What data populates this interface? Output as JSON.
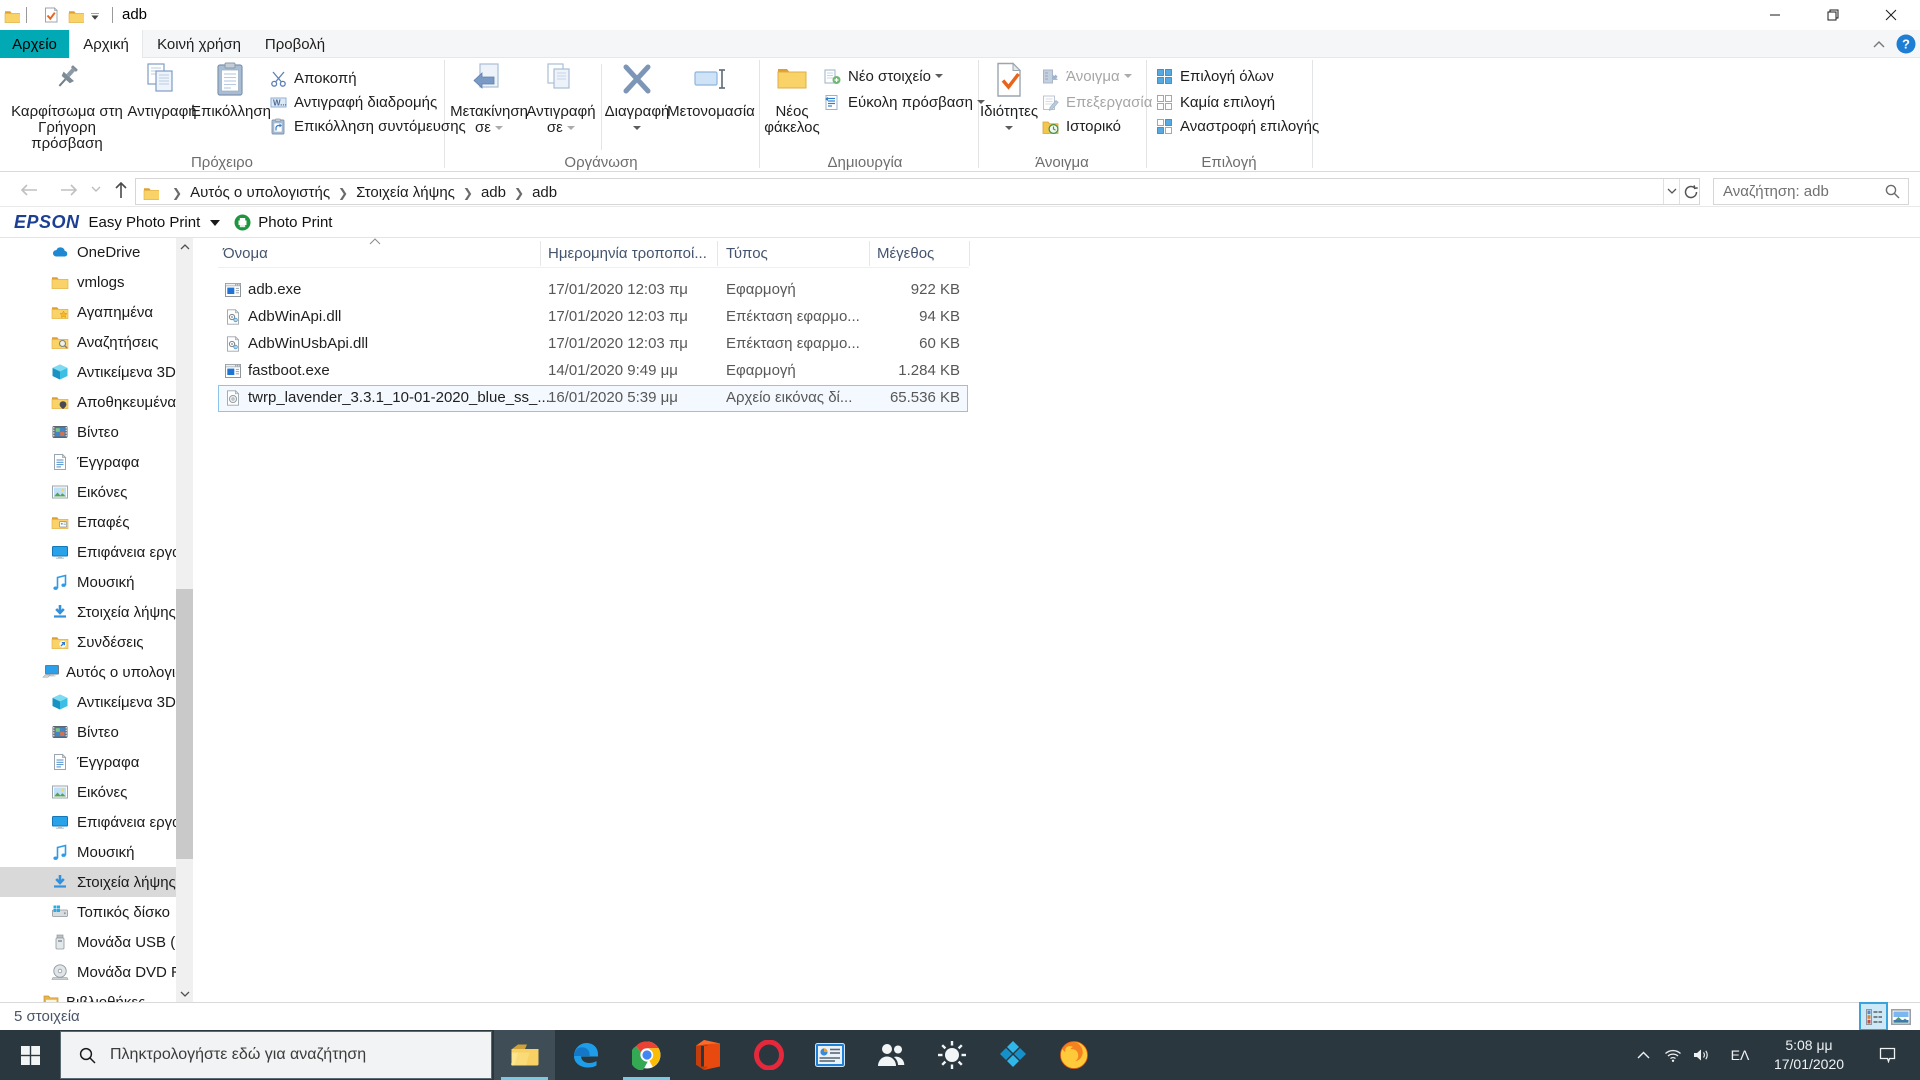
{
  "titlebar": {
    "title": "adb",
    "qat_icons": [
      "folder-icon",
      "properties-check-icon",
      "new-folder-icon",
      "customize-qat-caret"
    ],
    "window_buttons": [
      "minimize",
      "restore",
      "close"
    ]
  },
  "tabs": {
    "file_tab": "Αρχείο",
    "items": [
      {
        "label": "Αρχική",
        "active": true
      },
      {
        "label": "Κοινή χρήση",
        "active": false
      },
      {
        "label": "Προβολή",
        "active": false
      }
    ]
  },
  "ribbon": {
    "groups": [
      {
        "label": "Πρόχειρο"
      },
      {
        "label": "Οργάνωση"
      },
      {
        "label": "Δημιουργία"
      },
      {
        "label": "Άνοιγμα"
      },
      {
        "label": "Επιλογή"
      }
    ],
    "buttons": {
      "pin_line1": "Καρφίτσωμα στη",
      "pin_line2": "Γρήγορη πρόσβαση",
      "copy": "Αντιγραφή",
      "paste": "Επικόλληση",
      "cut": "Αποκοπή",
      "copy_path": "Αντιγραφή διαδρομής",
      "paste_shortcut": "Επικόλληση συντόμευσης",
      "move_to_line1": "Μετακίνηση",
      "move_to_line2": "σε",
      "copy_to_line1": "Αντιγραφή",
      "copy_to_line2": "σε",
      "delete": "Διαγραφή",
      "rename": "Μετονομασία",
      "new_folder_line1": "Νέος",
      "new_folder_line2": "φάκελος",
      "new_item": "Νέο στοιχείο",
      "easy_access": "Εύκολη πρόσβαση",
      "properties": "Ιδιότητες",
      "open": "Άνοιγμα",
      "edit": "Επεξεργασία",
      "history": "Ιστορικό",
      "select_all": "Επιλογή όλων",
      "select_none": "Καμία επιλογή",
      "invert_selection": "Αναστροφή επιλογής"
    }
  },
  "addressbar": {
    "breadcrumbs": [
      "Αυτός ο υπολογιστής",
      "Στοιχεία λήψης",
      "adb",
      "adb"
    ],
    "search_text": "Αναζήτηση: adb"
  },
  "epson_toolbar": {
    "brand": "EPSON",
    "menu_label": "Easy Photo Print",
    "button_label": "Photo Print"
  },
  "sidebar": {
    "items": [
      {
        "label": "OneDrive",
        "icon": "onedrive",
        "level": 1,
        "selected": false
      },
      {
        "label": "vmlogs",
        "icon": "folder",
        "level": 1,
        "selected": false
      },
      {
        "label": "Αγαπημένα",
        "icon": "folder-star",
        "level": 1,
        "selected": false
      },
      {
        "label": "Αναζητήσεις",
        "icon": "folder-search",
        "level": 1,
        "selected": false
      },
      {
        "label": "Αντικείμενα 3D",
        "icon": "cube",
        "level": 1,
        "selected": false
      },
      {
        "label": "Αποθηκευμένα παιχνίδια",
        "icon": "folder-saved",
        "level": 1,
        "selected": false
      },
      {
        "label": "Βίντεο",
        "icon": "video",
        "level": 1,
        "selected": false
      },
      {
        "label": "Έγγραφα",
        "icon": "document",
        "level": 1,
        "selected": false
      },
      {
        "label": "Εικόνες",
        "icon": "picture",
        "level": 1,
        "selected": false
      },
      {
        "label": "Επαφές",
        "icon": "folder-contact",
        "level": 1,
        "selected": false
      },
      {
        "label": "Επιφάνεια εργασίας",
        "icon": "desktop",
        "level": 1,
        "selected": false
      },
      {
        "label": "Μουσική",
        "icon": "music",
        "level": 1,
        "selected": false
      },
      {
        "label": "Στοιχεία λήψης",
        "icon": "download",
        "level": 1,
        "selected": false
      },
      {
        "label": "Συνδέσεις",
        "icon": "folder-link",
        "level": 1,
        "selected": false
      },
      {
        "label": "Αυτός ο υπολογιστής",
        "icon": "computer",
        "level": 0,
        "selected": false
      },
      {
        "label": "Αντικείμενα 3D",
        "icon": "cube",
        "level": 1,
        "selected": false
      },
      {
        "label": "Βίντεο",
        "icon": "video",
        "level": 1,
        "selected": false
      },
      {
        "label": "Έγγραφα",
        "icon": "document",
        "level": 1,
        "selected": false
      },
      {
        "label": "Εικόνες",
        "icon": "picture",
        "level": 1,
        "selected": false
      },
      {
        "label": "Επιφάνεια εργασίας",
        "icon": "desktop",
        "level": 1,
        "selected": false
      },
      {
        "label": "Μουσική",
        "icon": "music",
        "level": 1,
        "selected": false
      },
      {
        "label": "Στοιχεία λήψης",
        "icon": "download",
        "level": 1,
        "selected": true
      },
      {
        "label": "Τοπικός δίσκο",
        "icon": "disk",
        "level": 1,
        "selected": false
      },
      {
        "label": "Μονάδα USB (",
        "icon": "usb",
        "level": 1,
        "selected": false
      },
      {
        "label": "Μονάδα DVD R",
        "icon": "dvd",
        "level": 1,
        "selected": false
      },
      {
        "label": "Βιβλιοθήκες",
        "icon": "libraries",
        "level": 0,
        "selected": false
      }
    ]
  },
  "filelist": {
    "columns": [
      {
        "label": "Όνομα"
      },
      {
        "label": "Ημερομηνία τροποποί..."
      },
      {
        "label": "Τύπος"
      },
      {
        "label": "Μέγεθος"
      }
    ],
    "rows": [
      {
        "name": "adb.exe",
        "icon": "exe",
        "date": "17/01/2020 12:03 πμ",
        "type": "Εφαρμογή",
        "size": "922 KB",
        "selected": false
      },
      {
        "name": "AdbWinApi.dll",
        "icon": "dll",
        "date": "17/01/2020 12:03 πμ",
        "type": "Επέκταση εφαρμο...",
        "size": "94 KB",
        "selected": false
      },
      {
        "name": "AdbWinUsbApi.dll",
        "icon": "dll",
        "date": "17/01/2020 12:03 πμ",
        "type": "Επέκταση εφαρμο...",
        "size": "60 KB",
        "selected": false
      },
      {
        "name": "fastboot.exe",
        "icon": "exe",
        "date": "14/01/2020 9:49 μμ",
        "type": "Εφαρμογή",
        "size": "1.284 KB",
        "selected": false
      },
      {
        "name": "twrp_lavender_3.3.1_10-01-2020_blue_ss_...",
        "icon": "disc",
        "date": "16/01/2020 5:39 μμ",
        "type": "Αρχείο εικόνας δί...",
        "size": "65.536 KB",
        "selected": true
      }
    ]
  },
  "statusbar": {
    "items_count": "5 στοιχεία"
  },
  "taskbar": {
    "search_placeholder": "Πληκτρολογήστε εδώ για αναζήτηση",
    "apps": [
      {
        "name": "file-explorer",
        "active": true,
        "running": true
      },
      {
        "name": "edge",
        "active": false,
        "running": false
      },
      {
        "name": "chrome",
        "active": false,
        "running": true
      },
      {
        "name": "office",
        "active": false,
        "running": false
      },
      {
        "name": "opera",
        "active": false,
        "running": false
      },
      {
        "name": "mail-cards",
        "active": false,
        "running": false
      },
      {
        "name": "people",
        "active": false,
        "running": false
      },
      {
        "name": "sun",
        "active": false,
        "running": false
      },
      {
        "name": "kodi",
        "active": false,
        "running": false
      },
      {
        "name": "firefox",
        "active": false,
        "running": false
      }
    ],
    "tray": {
      "lang": "ΕΛ",
      "time": "5:08 μμ",
      "date": "17/01/2020"
    }
  },
  "colors": {
    "file_tab_teal": "#00a9b4",
    "taskbar_dark": "#2a373e",
    "running_underline": "#76cbe3",
    "selection_border": "#8cc5ec",
    "sidebar_selected": "#d9d9d9",
    "column_header_text": "#44546f"
  }
}
